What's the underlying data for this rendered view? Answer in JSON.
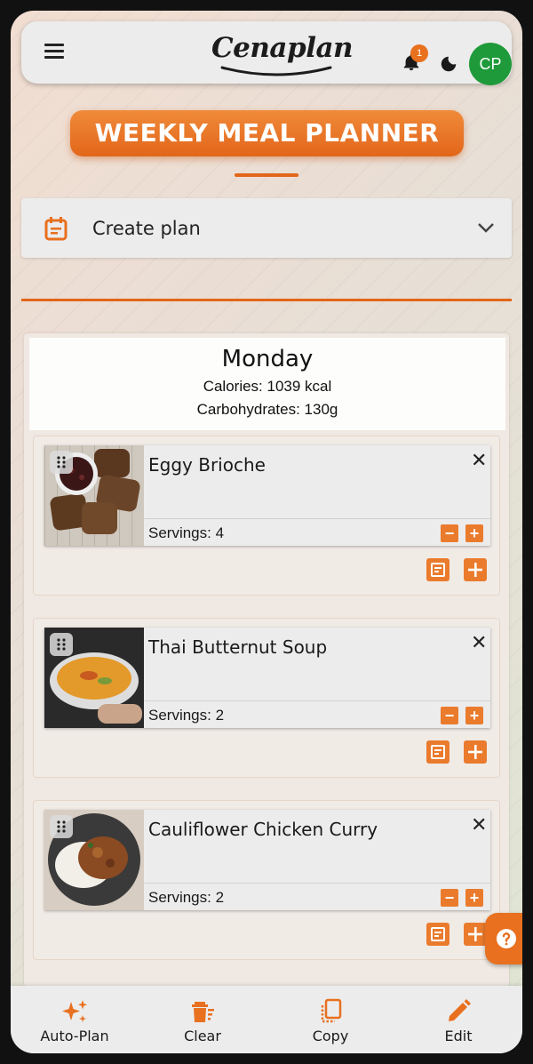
{
  "app": {
    "logo_text": "Cenaplan",
    "notification_count": "1",
    "avatar_initials": "CP"
  },
  "page": {
    "title": "WEEKLY MEAL PLANNER"
  },
  "create_plan": {
    "label": "Create plan"
  },
  "day": {
    "name": "Monday",
    "calories": "Calories: 1039 kcal",
    "carbohydrates": "Carbohydrates: 130g"
  },
  "meals": [
    {
      "name": "Eggy Brioche",
      "servings": "Servings: 4",
      "image": "eggy-brioche-photo"
    },
    {
      "name": "Thai Butternut Soup",
      "servings": "Servings: 2",
      "image": "thai-butternut-soup-photo"
    },
    {
      "name": "Cauliflower Chicken Curry",
      "servings": "Servings: 2",
      "image": "cauliflower-chicken-curry-photo"
    }
  ],
  "bottom_nav": [
    {
      "label": "Auto-Plan",
      "icon": "sparkles-icon"
    },
    {
      "label": "Clear",
      "icon": "trash-icon"
    },
    {
      "label": "Copy",
      "icon": "copy-icon"
    },
    {
      "label": "Edit",
      "icon": "pencil-icon"
    }
  ],
  "colors": {
    "accent": "#e8701f",
    "avatar": "#1f9a3a",
    "surface": "#ececec"
  }
}
